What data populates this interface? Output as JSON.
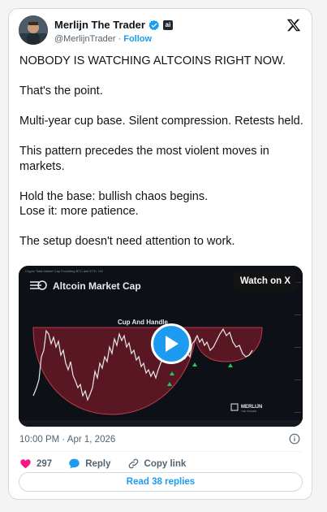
{
  "author": {
    "name": "Merlijn The Trader",
    "handle": "@MerlijnTrader",
    "separator": "·",
    "follow_label": "Follow",
    "affiliate_badge": "ai"
  },
  "tweet": {
    "paragraphs": [
      "NOBODY IS WATCHING ALTCOINS RIGHT NOW.",
      "That's the point.",
      "Multi-year cup base. Silent compression. Retests held.",
      "This pattern precedes the most violent moves in markets.",
      "Hold the base: bullish chaos begins.\nLose it: more patience.",
      "The setup doesn't need attention to work."
    ]
  },
  "media": {
    "chart_title": "Altcoin Market Cap",
    "pattern_label": "Cup And Handle",
    "watch_label": "Watch on X",
    "brand": "MERLIJN",
    "brand_sub": "THE TRADER",
    "header_strip": "Crypto Total Market Cap Excluding BTC and ETH, 1W"
  },
  "footer": {
    "timestamp": "10:00 PM · Apr 1, 2026",
    "likes": "297",
    "reply_label": "Reply",
    "copy_link_label": "Copy link",
    "read_replies_label": "Read 38 replies"
  },
  "icons": {
    "verified": "verified-badge-icon",
    "x_logo": "x-logo-icon",
    "heart": "heart-icon",
    "reply": "reply-bubble-icon",
    "link": "link-icon",
    "info": "info-icon",
    "play": "play-icon"
  },
  "colors": {
    "accent": "#1d9bf0",
    "like": "#f91880",
    "cup_fill": "#7a1a2a",
    "arrow_green": "#22c55e"
  }
}
